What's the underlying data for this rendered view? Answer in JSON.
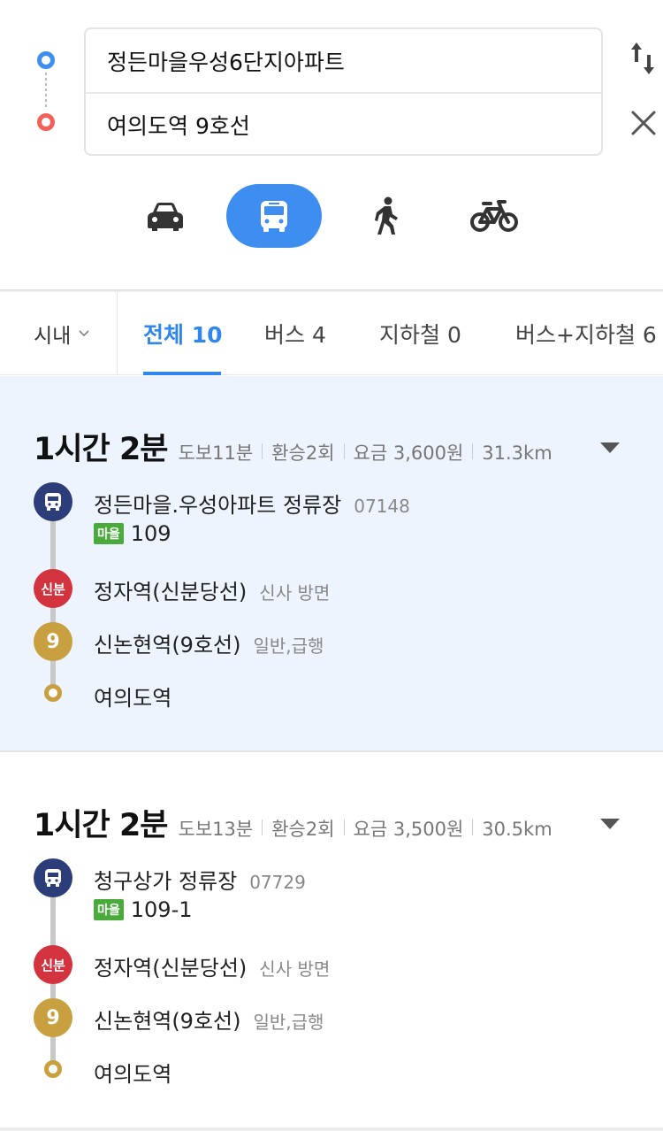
{
  "search": {
    "origin": "정든마을우성6단지아파트",
    "destination": "여의도역 9호선"
  },
  "colors": {
    "accent": "#3d8ef0",
    "tab_active": "#2f86ec",
    "bus_badge": "#2c3d7a",
    "sinbundang": "#d2333f",
    "line9": "#c9a03f",
    "village_bus": "#4aab3c",
    "selected_card_bg": "#edf4fd"
  },
  "modes": [
    {
      "name": "car",
      "icon": "car-icon",
      "active": false
    },
    {
      "name": "transit",
      "icon": "bus-icon",
      "active": true
    },
    {
      "name": "walk",
      "icon": "walk-icon",
      "active": false
    },
    {
      "name": "bike",
      "icon": "bike-icon",
      "active": false
    }
  ],
  "filter": {
    "city": "시내",
    "tabs": [
      {
        "label": "전체 10",
        "active": true
      },
      {
        "label": "버스 4",
        "active": false
      },
      {
        "label": "지하철 0",
        "active": false
      },
      {
        "label": "버스+지하철 6",
        "active": false
      }
    ]
  },
  "routes": [
    {
      "duration": "1시간 2분",
      "walk": "도보11분",
      "transfers": "환승2회",
      "fare": "요금 3,600원",
      "distance": "31.3km",
      "board_stop": "정든마을.우성아파트 정류장",
      "board_stop_id": "07148",
      "bus_type": "마을",
      "bus_number": "109",
      "transfer1_badge": "신분",
      "transfer1_name": "정자역(신분당선)",
      "transfer1_dir": "신사 방면",
      "transfer2_badge": "9",
      "transfer2_name": "신논현역(9호선)",
      "transfer2_dir": "일반,급행",
      "arrival": "여의도역"
    },
    {
      "duration": "1시간 2분",
      "walk": "도보13분",
      "transfers": "환승2회",
      "fare": "요금 3,500원",
      "distance": "30.5km",
      "board_stop": "청구상가 정류장",
      "board_stop_id": "07729",
      "bus_type": "마을",
      "bus_number": "109-1",
      "transfer1_badge": "신분",
      "transfer1_name": "정자역(신분당선)",
      "transfer1_dir": "신사 방면",
      "transfer2_badge": "9",
      "transfer2_name": "신논현역(9호선)",
      "transfer2_dir": "일반,급행",
      "arrival": "여의도역"
    }
  ]
}
